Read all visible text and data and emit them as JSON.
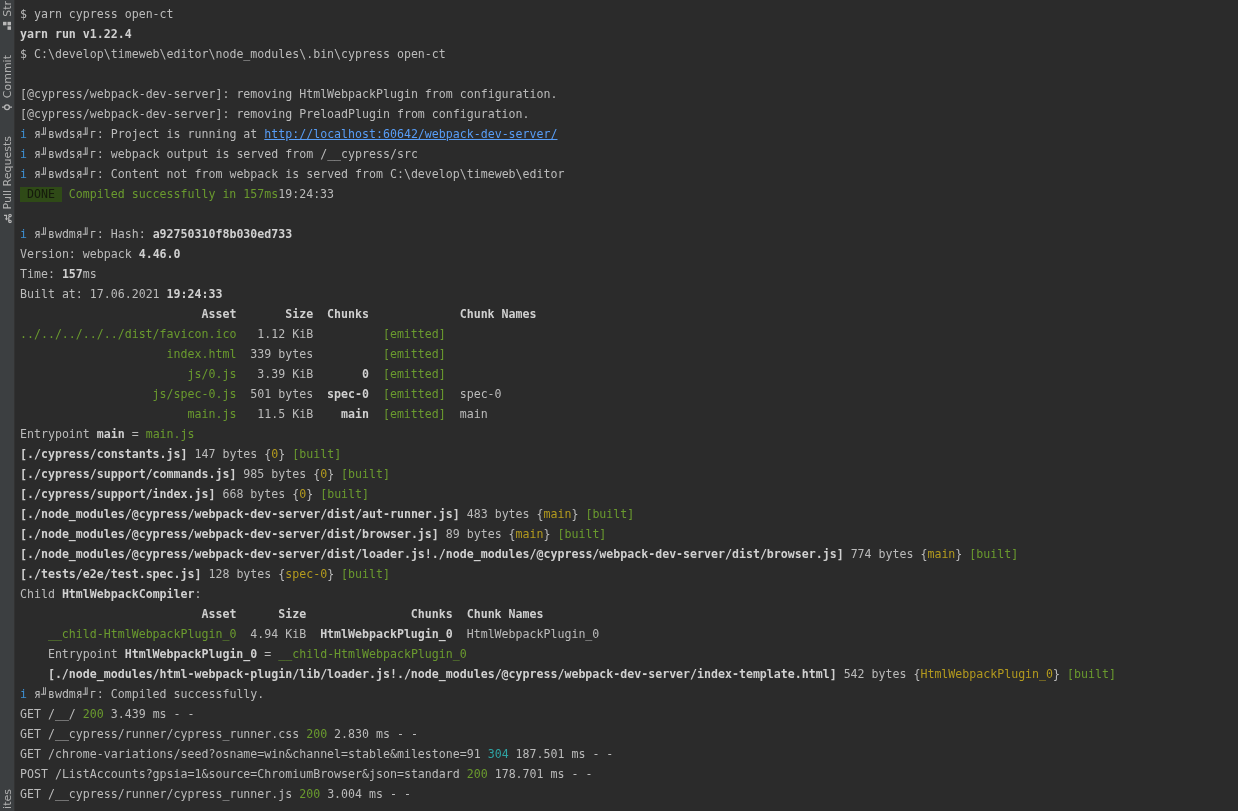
{
  "sidebar": {
    "items": [
      {
        "label": "Str",
        "kind": "structure"
      },
      {
        "label": "Commit",
        "kind": "commit"
      },
      {
        "label": "Pull Requests",
        "kind": "pull-request"
      },
      {
        "label": "ites",
        "kind": "plain"
      }
    ]
  },
  "terminal": {
    "lines": [
      {
        "kind": "line",
        "segments": [
          {
            "t": "$ yarn cypress open-ct",
            "kind": "plain"
          }
        ]
      },
      {
        "kind": "line",
        "segments": [
          {
            "t": "yarn run v1.22.4",
            "kind": "bold"
          }
        ]
      },
      {
        "kind": "line",
        "segments": [
          {
            "t": "$ C:\\develop\\timeweb\\editor\\node_modules\\.bin\\cypress open-ct",
            "kind": "plain"
          }
        ]
      },
      {
        "kind": "blank"
      },
      {
        "kind": "line",
        "segments": [
          {
            "t": "[@cypress/webpack-dev-server]: removing HtmlWebpackPlugin from configuration.",
            "kind": "plain"
          }
        ]
      },
      {
        "kind": "line",
        "segments": [
          {
            "t": "[@cypress/webpack-dev-server]: removing PreloadPlugin from configuration.",
            "kind": "plain"
          }
        ]
      },
      {
        "kind": "line",
        "segments": [
          {
            "t": "i",
            "kind": "info"
          },
          {
            "t": " я╜вwdsя╜г: Project is running at ",
            "kind": "plain"
          },
          {
            "t": "http://localhost:60642/webpack-dev-server/",
            "kind": "link"
          }
        ]
      },
      {
        "kind": "line",
        "segments": [
          {
            "t": "i",
            "kind": "info"
          },
          {
            "t": " я╜вwdsя╜г: webpack output is served from /__cypress/src",
            "kind": "plain"
          }
        ]
      },
      {
        "kind": "line",
        "segments": [
          {
            "t": "i",
            "kind": "info"
          },
          {
            "t": " я╜вwdsя╜г: Content not from webpack is served from C:\\develop\\timeweb\\editor",
            "kind": "plain"
          }
        ]
      },
      {
        "kind": "line",
        "segments": [
          {
            "t": "DONE",
            "kind": "badge"
          },
          {
            "t": "Compiled successfully in 157ms",
            "kind": "green"
          },
          {
            "t": "19:24:33",
            "kind": "plain"
          }
        ]
      },
      {
        "kind": "blank"
      },
      {
        "kind": "line",
        "segments": [
          {
            "t": "i",
            "kind": "info"
          },
          {
            "t": " я╜вwdmя╜г: Hash: ",
            "kind": "plain"
          },
          {
            "t": "a92750310f8b030ed733",
            "kind": "bold"
          }
        ]
      },
      {
        "kind": "line",
        "segments": [
          {
            "t": "Version: webpack ",
            "kind": "plain"
          },
          {
            "t": "4.46.0",
            "kind": "bold"
          }
        ]
      },
      {
        "kind": "line",
        "segments": [
          {
            "t": "Time: ",
            "kind": "plain"
          },
          {
            "t": "157",
            "kind": "bold"
          },
          {
            "t": "ms",
            "kind": "plain"
          }
        ]
      },
      {
        "kind": "line",
        "segments": [
          {
            "t": "Built at: 17.06.2021 ",
            "kind": "plain"
          },
          {
            "t": "19:24:33",
            "kind": "bold"
          }
        ]
      },
      {
        "kind": "asset-table",
        "columns": [
          "Asset",
          "Size",
          "Chunks",
          "Chunk Names"
        ],
        "rows": [
          {
            "asset": "../../../../../dist/favicon.ico",
            "size": "1.12 KiB",
            "status": "[emitted]"
          },
          {
            "asset": "index.html",
            "size": "339 bytes",
            "status": "[emitted]"
          },
          {
            "asset": "js/0.js",
            "size": "3.39 KiB",
            "chunks": "0",
            "status": "[emitted]"
          },
          {
            "asset": "js/spec-0.js",
            "size": "501 bytes",
            "chunks": "spec-0",
            "status": "[emitted]",
            "chunk_names": "spec-0"
          },
          {
            "asset": "main.js",
            "size": "11.5 KiB",
            "chunks": "main",
            "status": "[emitted]",
            "chunk_names": "main"
          }
        ]
      },
      {
        "kind": "line",
        "segments": [
          {
            "t": "Entrypoint ",
            "kind": "plain"
          },
          {
            "t": "main",
            "kind": "bold"
          },
          {
            "t": " = ",
            "kind": "plain"
          },
          {
            "t": "main.js",
            "kind": "green"
          }
        ]
      },
      {
        "kind": "line",
        "segments": [
          {
            "t": "[./cypress/constants.js]",
            "kind": "bold"
          },
          {
            "t": " 147 bytes {",
            "kind": "plain"
          },
          {
            "t": "0",
            "kind": "yellow"
          },
          {
            "t": "} ",
            "kind": "plain"
          },
          {
            "t": "[built]",
            "kind": "green"
          }
        ]
      },
      {
        "kind": "line",
        "segments": [
          {
            "t": "[./cypress/support/commands.js]",
            "kind": "bold"
          },
          {
            "t": " 985 bytes {",
            "kind": "plain"
          },
          {
            "t": "0",
            "kind": "yellow"
          },
          {
            "t": "} ",
            "kind": "plain"
          },
          {
            "t": "[built]",
            "kind": "green"
          }
        ]
      },
      {
        "kind": "line",
        "segments": [
          {
            "t": "[./cypress/support/index.js]",
            "kind": "bold"
          },
          {
            "t": " 668 bytes {",
            "kind": "plain"
          },
          {
            "t": "0",
            "kind": "yellow"
          },
          {
            "t": "} ",
            "kind": "plain"
          },
          {
            "t": "[built]",
            "kind": "green"
          }
        ]
      },
      {
        "kind": "line",
        "segments": [
          {
            "t": "[./node_modules/@cypress/webpack-dev-server/dist/aut-runner.js]",
            "kind": "bold"
          },
          {
            "t": " 483 bytes {",
            "kind": "plain"
          },
          {
            "t": "main",
            "kind": "yellow"
          },
          {
            "t": "} ",
            "kind": "plain"
          },
          {
            "t": "[built]",
            "kind": "green"
          }
        ]
      },
      {
        "kind": "line",
        "segments": [
          {
            "t": "[./node_modules/@cypress/webpack-dev-server/dist/browser.js]",
            "kind": "bold"
          },
          {
            "t": " 89 bytes {",
            "kind": "plain"
          },
          {
            "t": "main",
            "kind": "yellow"
          },
          {
            "t": "} ",
            "kind": "plain"
          },
          {
            "t": "[built]",
            "kind": "green"
          }
        ]
      },
      {
        "kind": "line",
        "segments": [
          {
            "t": "[./node_modules/@cypress/webpack-dev-server/dist/loader.js!./node_modules/@cypress/webpack-dev-server/dist/browser.js]",
            "kind": "bold"
          },
          {
            "t": " 774 bytes {",
            "kind": "plain"
          },
          {
            "t": "main",
            "kind": "yellow"
          },
          {
            "t": "} ",
            "kind": "plain"
          },
          {
            "t": "[built]",
            "kind": "green"
          }
        ]
      },
      {
        "kind": "line",
        "segments": [
          {
            "t": "[./tests/e2e/test.spec.js]",
            "kind": "bold"
          },
          {
            "t": " 128 bytes {",
            "kind": "plain"
          },
          {
            "t": "spec-0",
            "kind": "yellow"
          },
          {
            "t": "} ",
            "kind": "plain"
          },
          {
            "t": "[built]",
            "kind": "green"
          }
        ]
      },
      {
        "kind": "line",
        "segments": [
          {
            "t": "Child ",
            "kind": "plain"
          },
          {
            "t": "HtmlWebpackCompiler",
            "kind": "bold"
          },
          {
            "t": ":",
            "kind": "plain"
          }
        ],
        "children": [
          {
            "kind": "child-asset-table",
            "columns": [
              "Asset",
              "Size",
              "Chunks",
              "Chunk Names"
            ],
            "rows": [
              {
                "asset": "__child-HtmlWebpackPlugin_0",
                "size": "4.94 KiB",
                "chunks": "HtmlWebpackPlugin_0",
                "chunk_names": "HtmlWebpackPlugin_0"
              }
            ]
          },
          {
            "kind": "line",
            "segments": [
              {
                "t": "Entrypoint ",
                "kind": "plain"
              },
              {
                "t": "HtmlWebpackPlugin_0",
                "kind": "bold"
              },
              {
                "t": " = ",
                "kind": "plain"
              },
              {
                "t": "__child-HtmlWebpackPlugin_0",
                "kind": "green"
              }
            ]
          },
          {
            "kind": "line",
            "segments": [
              {
                "t": "[./node_modules/html-webpack-plugin/lib/loader.js!./node_modules/@cypress/webpack-dev-server/index-template.html]",
                "kind": "bold"
              },
              {
                "t": " 542 bytes {",
                "kind": "plain"
              },
              {
                "t": "HtmlWebpackPlugin_0",
                "kind": "yellow"
              },
              {
                "t": "} ",
                "kind": "plain"
              },
              {
                "t": "[built]",
                "kind": "green"
              }
            ]
          }
        ]
      },
      {
        "kind": "line",
        "segments": [
          {
            "t": "i",
            "kind": "info"
          },
          {
            "t": " я╜вwdmя╜г: Compiled successfully.",
            "kind": "plain"
          }
        ]
      },
      {
        "kind": "line",
        "segments": [
          {
            "t": "GET /__/ ",
            "kind": "plain"
          },
          {
            "t": "200",
            "kind": "green"
          },
          {
            "t": " 3.439 ms - -",
            "kind": "plain"
          }
        ]
      },
      {
        "kind": "line",
        "segments": [
          {
            "t": "GET /__cypress/runner/cypress_runner.css ",
            "kind": "plain"
          },
          {
            "t": "200",
            "kind": "green"
          },
          {
            "t": " 2.830 ms - -",
            "kind": "plain"
          }
        ]
      },
      {
        "kind": "line",
        "segments": [
          {
            "t": "GET /chrome-variations/seed?osname=win&channel=stable&milestone=91 ",
            "kind": "plain"
          },
          {
            "t": "304",
            "kind": "teal"
          },
          {
            "t": " 187.501 ms - -",
            "kind": "plain"
          }
        ]
      },
      {
        "kind": "line",
        "segments": [
          {
            "t": "POST /ListAccounts?gpsia=1&source=ChromiumBrowser&json=standard ",
            "kind": "plain"
          },
          {
            "t": "200",
            "kind": "green"
          },
          {
            "t": " 178.701 ms - -",
            "kind": "plain"
          }
        ]
      },
      {
        "kind": "line",
        "segments": [
          {
            "t": "GET /__cypress/runner/cypress_runner.js ",
            "kind": "plain"
          },
          {
            "t": "200",
            "kind": "green"
          },
          {
            "t": " 3.004 ms - -",
            "kind": "plain"
          }
        ]
      }
    ]
  }
}
